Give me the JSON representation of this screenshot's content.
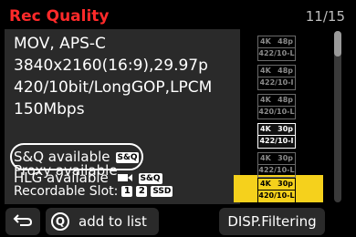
{
  "header": {
    "title": "Rec Quality",
    "page": "11/15"
  },
  "info": {
    "codec": "MOV, APS-C",
    "resolution": "3840x2160(16:9),29.97p",
    "bitdepth": "420/10bit/LongGOP,LPCM",
    "bitrate": "150Mbps",
    "sq": "S&Q available",
    "sq_badge": "S&Q",
    "hlg": "HLG available",
    "hlg_badge": "S&Q",
    "proxy": "Proxy available",
    "slot_label": "Recordable Slot:",
    "slot1": "1",
    "slot2": "2",
    "slot_ssd": "SSD"
  },
  "chips": [
    {
      "res": "4K",
      "rate": "48p",
      "format": "422/10-L",
      "state": "dim"
    },
    {
      "res": "4K",
      "rate": "48p",
      "format": "422/10-I",
      "state": "dim"
    },
    {
      "res": "4K",
      "rate": "48p",
      "format": "420/10-L",
      "state": "dim"
    },
    {
      "res": "4K",
      "rate": "30p",
      "format": "422/10-I",
      "state": "active"
    },
    {
      "res": "4K",
      "rate": "30p",
      "format": "422/10-L",
      "state": "dim"
    },
    {
      "res": "4K",
      "rate": "30p",
      "format": "420/10-L",
      "state": "selected"
    }
  ],
  "footer": {
    "back_icon": "return-arrow-icon",
    "q_key": "Q",
    "add_label": "add to list",
    "disp_label": "DISP.Filtering"
  },
  "colors": {
    "title": "#ff2a2a",
    "selection": "#f5d11c",
    "panel": "#2a2a2a"
  }
}
